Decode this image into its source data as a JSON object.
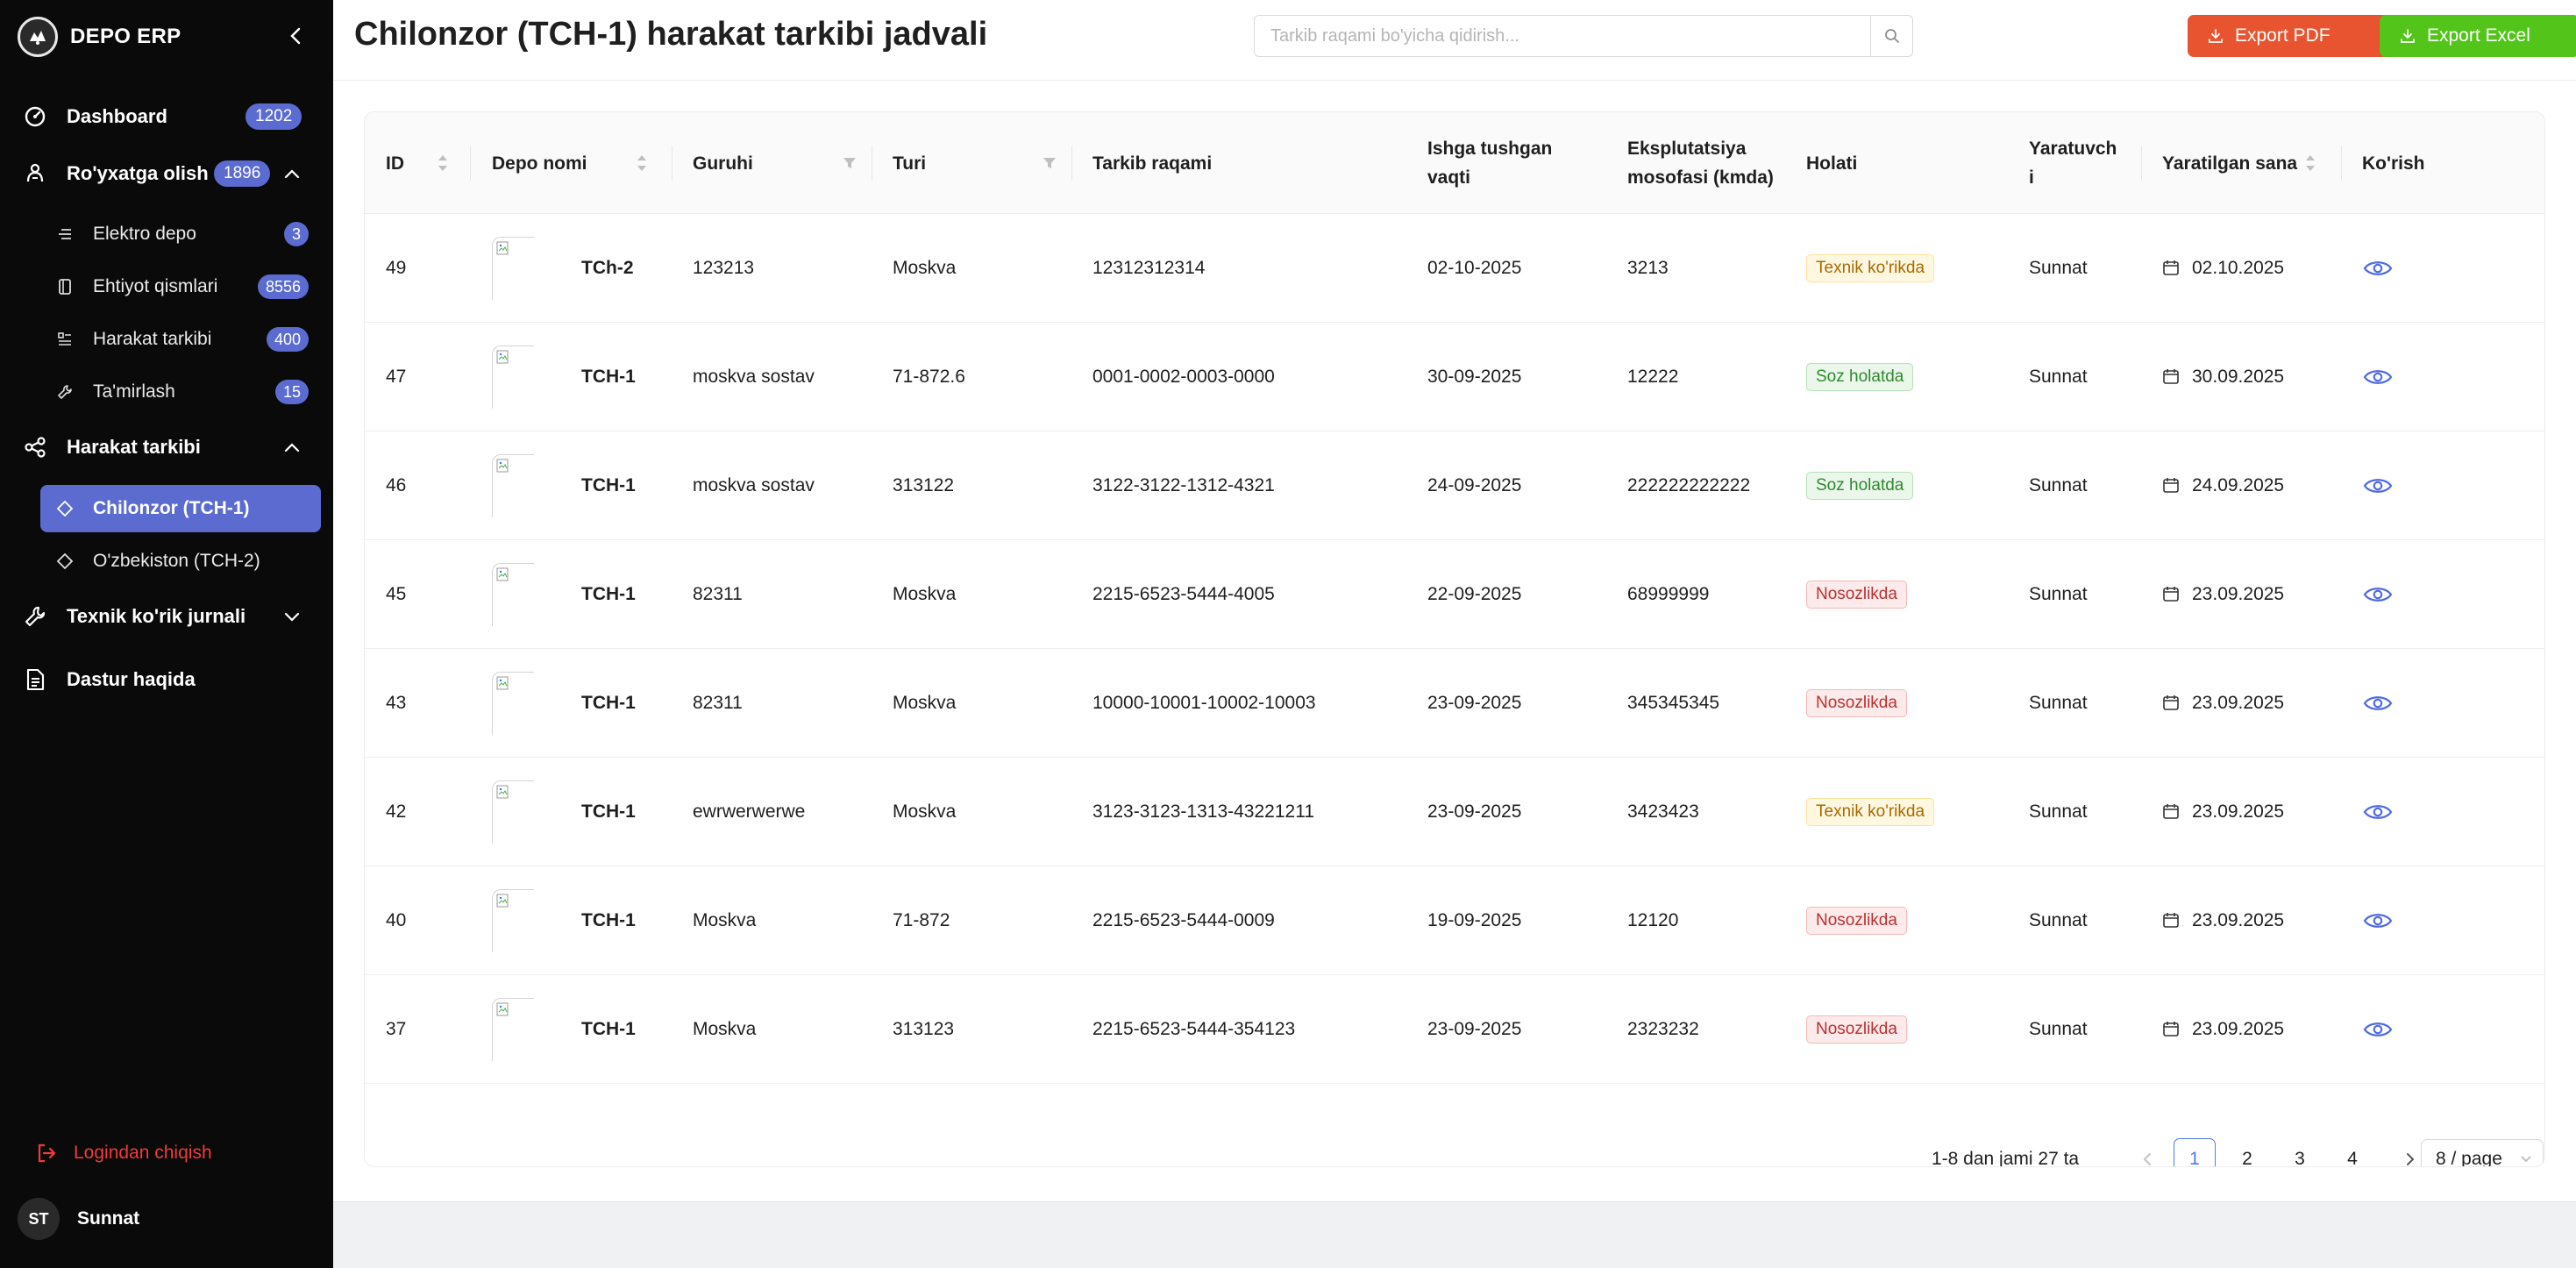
{
  "app": {
    "brand": "DEPO ERP"
  },
  "sidebar": {
    "dashboard": {
      "label": "Dashboard",
      "badge": "1202"
    },
    "registration": {
      "label": "Ro'yxatga olish",
      "badge": "1896"
    },
    "registration_items": [
      {
        "label": "Elektro depo",
        "badge": "3"
      },
      {
        "label": "Ehtiyot qismlari",
        "badge": "8556"
      },
      {
        "label": "Harakat tarkibi",
        "badge": "400"
      },
      {
        "label": "Ta'mirlash",
        "badge": "15"
      }
    ],
    "rolling_stock": {
      "label": "Harakat tarkibi"
    },
    "rolling_stock_items": [
      {
        "label": "Chilonzor (TCH-1)"
      },
      {
        "label": "O'zbekiston (TCH-2)"
      }
    ],
    "inspection_log": {
      "label": "Texnik ko'rik jurnali"
    },
    "about": {
      "label": "Dastur haqida"
    },
    "logout": {
      "label": "Logindan chiqish"
    },
    "user": {
      "initials": "ST",
      "name": "Sunnat"
    }
  },
  "header": {
    "title": "Chilonzor (TCH-1) harakat tarkibi jadvali",
    "search_placeholder": "Tarkib raqami bo'yicha qidirish...",
    "export_pdf": "Export PDF",
    "export_excel": "Export Excel"
  },
  "table": {
    "columns": {
      "id": "ID",
      "depot": "Depo nomi",
      "group": "Guruhi",
      "type": "Turi",
      "number": "Tarkib raqami",
      "start_line1": "Ishga tushgan",
      "start_line2": "vaqti",
      "mileage_line1": "Eksplutatsiya",
      "mileage_line2": "mosofasi (kmda)",
      "status": "Holati",
      "creator_line1": "Yaratuvch",
      "creator_line2": "i",
      "created": "Yaratilgan sana",
      "view": "Ko'rish"
    },
    "rows": [
      {
        "id": "49",
        "depot": "TCh-2",
        "group": "123213",
        "type": "Moskva",
        "number": "12312312314",
        "start": "02-10-2025",
        "mileage": "3213",
        "status": "Texnik ko'rikda",
        "status_kind": "warning",
        "creator": "Sunnat",
        "created": "02.10.2025"
      },
      {
        "id": "47",
        "depot": "TCH-1",
        "group": "moskva sostav",
        "type": "71-872.6",
        "number": "0001-0002-0003-0000",
        "start": "30-09-2025",
        "mileage": "12222",
        "status": "Soz holatda",
        "status_kind": "success",
        "creator": "Sunnat",
        "created": "30.09.2025"
      },
      {
        "id": "46",
        "depot": "TCH-1",
        "group": "moskva sostav",
        "type": "313122",
        "number": "3122-3122-1312-4321",
        "start": "24-09-2025",
        "mileage": "222222222222",
        "status": "Soz holatda",
        "status_kind": "success",
        "creator": "Sunnat",
        "created": "24.09.2025"
      },
      {
        "id": "45",
        "depot": "TCH-1",
        "group": "82311",
        "type": "Moskva",
        "number": "2215-6523-5444-4005",
        "start": "22-09-2025",
        "mileage": "68999999",
        "status": "Nosozlikda",
        "status_kind": "error",
        "creator": "Sunnat",
        "created": "23.09.2025"
      },
      {
        "id": "43",
        "depot": "TCH-1",
        "group": "82311",
        "type": "Moskva",
        "number": "10000-10001-10002-10003",
        "start": "23-09-2025",
        "mileage": "345345345",
        "status": "Nosozlikda",
        "status_kind": "error",
        "creator": "Sunnat",
        "created": "23.09.2025"
      },
      {
        "id": "42",
        "depot": "TCH-1",
        "group": "ewrwerwerwe",
        "type": "Moskva",
        "number": "3123-3123-1313-43221211",
        "start": "23-09-2025",
        "mileage": "3423423",
        "status": "Texnik ko'rikda",
        "status_kind": "warning",
        "creator": "Sunnat",
        "created": "23.09.2025"
      },
      {
        "id": "40",
        "depot": "TCH-1",
        "group": "Moskva",
        "type": "71-872",
        "number": "2215-6523-5444-0009",
        "start": "19-09-2025",
        "mileage": "12120",
        "status": "Nosozlikda",
        "status_kind": "error",
        "creator": "Sunnat",
        "created": "23.09.2025"
      },
      {
        "id": "37",
        "depot": "TCH-1",
        "group": "Moskva",
        "type": "313123",
        "number": "2215-6523-5444-354123",
        "start": "23-09-2025",
        "mileage": "2323232",
        "status": "Nosozlikda",
        "status_kind": "error",
        "creator": "Sunnat",
        "created": "23.09.2025"
      }
    ]
  },
  "pagination": {
    "total_text": "1-8 dan jami 27 ta",
    "pages": [
      "1",
      "2",
      "3",
      "4"
    ],
    "current": "1",
    "page_size": "8 / page"
  },
  "colors": {
    "sidebar_bg": "#0a0a0a",
    "accent": "#5b6bd0",
    "pdf_button": "#e8542f",
    "excel_button": "#52c41a",
    "link_blue": "#4f7be8",
    "logout_red": "#ef3b3b"
  }
}
